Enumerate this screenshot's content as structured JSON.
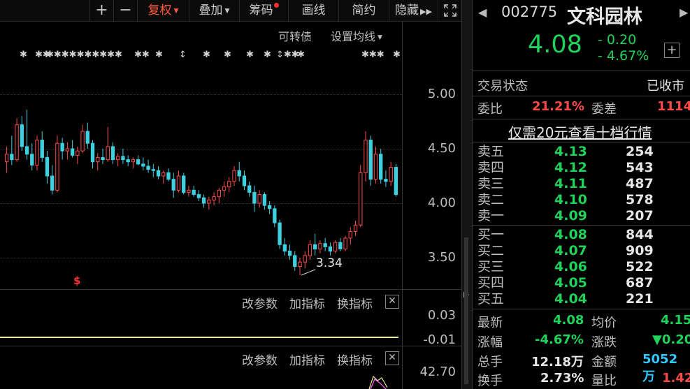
{
  "toolbar": {
    "plus": "+",
    "minus": "−",
    "fuquan": "复权",
    "diejia": "叠加",
    "chouma": "筹码",
    "huaxian": "画线",
    "jianyue": "简约",
    "yincang": "隐藏",
    "expand_icon": "fullscreen-icon"
  },
  "chart": {
    "convertible_bond": "可转债",
    "ma_settings": "设置均线",
    "price_ticks": [
      "5.00",
      "4.50",
      "4.00",
      "3.50"
    ],
    "low_marker": "3.34",
    "dividend_marker": "$",
    "sub1": {
      "ticks": [
        "0.03",
        "-0.01"
      ]
    },
    "sub2": {
      "ticks": [
        "42.70"
      ]
    },
    "sub_options": {
      "change_params": "改参数",
      "add_indicator": "加指标",
      "switch_indicator": "换指标"
    },
    "candles": [
      {
        "o": 4.38,
        "h": 4.52,
        "l": 4.28,
        "c": 4.45
      },
      {
        "o": 4.45,
        "h": 4.62,
        "l": 4.35,
        "c": 4.4
      },
      {
        "o": 4.4,
        "h": 4.78,
        "l": 4.38,
        "c": 4.72
      },
      {
        "o": 4.72,
        "h": 4.8,
        "l": 4.48,
        "c": 4.52
      },
      {
        "o": 4.52,
        "h": 4.86,
        "l": 4.4,
        "c": 4.45
      },
      {
        "o": 4.45,
        "h": 4.55,
        "l": 4.3,
        "c": 4.35
      },
      {
        "o": 4.35,
        "h": 4.62,
        "l": 4.3,
        "c": 4.58
      },
      {
        "o": 4.58,
        "h": 4.66,
        "l": 4.38,
        "c": 4.42
      },
      {
        "o": 4.42,
        "h": 4.48,
        "l": 4.18,
        "c": 4.25
      },
      {
        "o": 4.25,
        "h": 4.35,
        "l": 4.08,
        "c": 4.12
      },
      {
        "o": 4.12,
        "h": 4.62,
        "l": 4.1,
        "c": 4.55
      },
      {
        "o": 4.55,
        "h": 4.6,
        "l": 4.4,
        "c": 4.48
      },
      {
        "o": 4.48,
        "h": 4.56,
        "l": 4.4,
        "c": 4.5
      },
      {
        "o": 4.5,
        "h": 4.58,
        "l": 4.42,
        "c": 4.44
      },
      {
        "o": 4.44,
        "h": 4.52,
        "l": 4.36,
        "c": 4.48
      },
      {
        "o": 4.48,
        "h": 4.72,
        "l": 4.46,
        "c": 4.66
      },
      {
        "o": 4.66,
        "h": 4.74,
        "l": 4.5,
        "c": 4.55
      },
      {
        "o": 4.55,
        "h": 4.58,
        "l": 4.32,
        "c": 4.38
      },
      {
        "o": 4.38,
        "h": 4.46,
        "l": 4.3,
        "c": 4.42
      },
      {
        "o": 4.42,
        "h": 4.5,
        "l": 4.36,
        "c": 4.4
      },
      {
        "o": 4.4,
        "h": 4.7,
        "l": 4.38,
        "c": 4.52
      },
      {
        "o": 4.52,
        "h": 4.56,
        "l": 4.36,
        "c": 4.4
      },
      {
        "o": 4.4,
        "h": 4.46,
        "l": 4.34,
        "c": 4.43
      },
      {
        "o": 4.43,
        "h": 4.5,
        "l": 4.36,
        "c": 4.4
      },
      {
        "o": 4.4,
        "h": 4.44,
        "l": 4.34,
        "c": 4.38
      },
      {
        "o": 4.38,
        "h": 4.42,
        "l": 4.32,
        "c": 4.4
      },
      {
        "o": 4.4,
        "h": 4.44,
        "l": 4.35,
        "c": 4.36
      },
      {
        "o": 4.36,
        "h": 4.42,
        "l": 4.3,
        "c": 4.34
      },
      {
        "o": 4.34,
        "h": 4.4,
        "l": 4.28,
        "c": 4.31
      },
      {
        "o": 4.31,
        "h": 4.36,
        "l": 4.24,
        "c": 4.3
      },
      {
        "o": 4.3,
        "h": 4.34,
        "l": 4.22,
        "c": 4.25
      },
      {
        "o": 4.25,
        "h": 4.3,
        "l": 4.18,
        "c": 4.28
      },
      {
        "o": 4.28,
        "h": 4.32,
        "l": 4.2,
        "c": 4.22
      },
      {
        "o": 4.22,
        "h": 4.28,
        "l": 4.05,
        "c": 4.12
      },
      {
        "o": 4.12,
        "h": 4.3,
        "l": 4.1,
        "c": 4.25
      },
      {
        "o": 4.25,
        "h": 4.28,
        "l": 4.08,
        "c": 4.1
      },
      {
        "o": 4.1,
        "h": 4.16,
        "l": 4.06,
        "c": 4.12
      },
      {
        "o": 4.12,
        "h": 4.16,
        "l": 4.06,
        "c": 4.08
      },
      {
        "o": 4.08,
        "h": 4.12,
        "l": 4.02,
        "c": 4.05
      },
      {
        "o": 4.05,
        "h": 4.08,
        "l": 3.96,
        "c": 4.0
      },
      {
        "o": 4.0,
        "h": 4.06,
        "l": 3.94,
        "c": 4.03
      },
      {
        "o": 4.03,
        "h": 4.1,
        "l": 3.98,
        "c": 4.06
      },
      {
        "o": 4.06,
        "h": 4.14,
        "l": 4.0,
        "c": 4.12
      },
      {
        "o": 4.12,
        "h": 4.2,
        "l": 4.06,
        "c": 4.15
      },
      {
        "o": 4.15,
        "h": 4.24,
        "l": 4.1,
        "c": 4.2
      },
      {
        "o": 4.2,
        "h": 4.34,
        "l": 4.16,
        "c": 4.3
      },
      {
        "o": 4.3,
        "h": 4.38,
        "l": 4.2,
        "c": 4.25
      },
      {
        "o": 4.25,
        "h": 4.3,
        "l": 4.12,
        "c": 4.16
      },
      {
        "o": 4.16,
        "h": 4.2,
        "l": 4.06,
        "c": 4.1
      },
      {
        "o": 4.1,
        "h": 4.16,
        "l": 3.92,
        "c": 4.0
      },
      {
        "o": 4.0,
        "h": 4.12,
        "l": 3.96,
        "c": 4.08
      },
      {
        "o": 4.08,
        "h": 4.1,
        "l": 3.94,
        "c": 3.98
      },
      {
        "o": 3.98,
        "h": 4.02,
        "l": 3.9,
        "c": 3.95
      },
      {
        "o": 3.95,
        "h": 3.98,
        "l": 3.78,
        "c": 3.82
      },
      {
        "o": 3.82,
        "h": 3.85,
        "l": 3.58,
        "c": 3.62
      },
      {
        "o": 3.62,
        "h": 3.68,
        "l": 3.52,
        "c": 3.56
      },
      {
        "o": 3.56,
        "h": 3.62,
        "l": 3.48,
        "c": 3.52
      },
      {
        "o": 3.52,
        "h": 3.56,
        "l": 3.38,
        "c": 3.42
      },
      {
        "o": 3.42,
        "h": 3.5,
        "l": 3.34,
        "c": 3.46
      },
      {
        "o": 3.46,
        "h": 3.56,
        "l": 3.4,
        "c": 3.52
      },
      {
        "o": 3.52,
        "h": 3.66,
        "l": 3.48,
        "c": 3.62
      },
      {
        "o": 3.62,
        "h": 3.72,
        "l": 3.52,
        "c": 3.58
      },
      {
        "o": 3.58,
        "h": 3.66,
        "l": 3.54,
        "c": 3.63
      },
      {
        "o": 3.63,
        "h": 3.68,
        "l": 3.56,
        "c": 3.6
      },
      {
        "o": 3.6,
        "h": 3.64,
        "l": 3.52,
        "c": 3.56
      },
      {
        "o": 3.56,
        "h": 3.66,
        "l": 3.54,
        "c": 3.64
      },
      {
        "o": 3.64,
        "h": 3.68,
        "l": 3.56,
        "c": 3.58
      },
      {
        "o": 3.58,
        "h": 3.7,
        "l": 3.56,
        "c": 3.68
      },
      {
        "o": 3.68,
        "h": 3.78,
        "l": 3.62,
        "c": 3.74
      },
      {
        "o": 3.74,
        "h": 3.84,
        "l": 3.7,
        "c": 3.8
      },
      {
        "o": 3.8,
        "h": 4.35,
        "l": 3.78,
        "c": 4.28
      },
      {
        "o": 4.28,
        "h": 4.66,
        "l": 4.2,
        "c": 4.58
      },
      {
        "o": 4.58,
        "h": 4.62,
        "l": 4.16,
        "c": 4.22
      },
      {
        "o": 4.22,
        "h": 4.52,
        "l": 4.18,
        "c": 4.45
      },
      {
        "o": 4.45,
        "h": 4.5,
        "l": 4.18,
        "c": 4.22
      },
      {
        "o": 4.22,
        "h": 4.3,
        "l": 4.15,
        "c": 4.2
      },
      {
        "o": 4.2,
        "h": 4.38,
        "l": 4.16,
        "c": 4.33
      },
      {
        "o": 4.33,
        "h": 4.36,
        "l": 4.06,
        "c": 4.08
      }
    ]
  },
  "quote": {
    "code": "002775",
    "name": "文科园林",
    "price": "4.08",
    "change": "- 0.20",
    "change_pct": "- 4.67%",
    "trade_status_label": "交易状态",
    "trade_status": "已收市",
    "weibi_label": "委比",
    "weibi": "21.21%",
    "weicha_label": "委差",
    "weicha": "1114",
    "level2_link": "仅需20元查看十档行情"
  },
  "orderbook": {
    "asks": [
      {
        "label": "卖五",
        "price": "4.13",
        "vol": "254"
      },
      {
        "label": "卖四",
        "price": "4.12",
        "vol": "543"
      },
      {
        "label": "卖三",
        "price": "4.11",
        "vol": "487"
      },
      {
        "label": "卖二",
        "price": "4.10",
        "vol": "578"
      },
      {
        "label": "卖一",
        "price": "4.09",
        "vol": "207"
      }
    ],
    "bids": [
      {
        "label": "买一",
        "price": "4.08",
        "vol": "844"
      },
      {
        "label": "买二",
        "price": "4.07",
        "vol": "909"
      },
      {
        "label": "买三",
        "price": "4.06",
        "vol": "522"
      },
      {
        "label": "买四",
        "price": "4.05",
        "vol": "687"
      },
      {
        "label": "买五",
        "price": "4.04",
        "vol": "221"
      }
    ]
  },
  "stats": {
    "latest_label": "最新",
    "latest": "4.08",
    "avg_label": "均价",
    "avg": "4.15",
    "chg_pct_label": "涨幅",
    "chg_pct": "-4.67%",
    "chg_label": "涨跌",
    "chg": "▼0.20",
    "volume_label": "总手",
    "volume": "12.18万",
    "amount_label": "金额",
    "amount": "5052万",
    "turnover_label": "换手",
    "turnover": "2.73%",
    "vol_ratio_label": "量比",
    "vol_ratio": "1.42"
  },
  "colors": {
    "up": "#ff4a4a",
    "down": "#1fd35a",
    "accent": "#ff5a3c"
  }
}
